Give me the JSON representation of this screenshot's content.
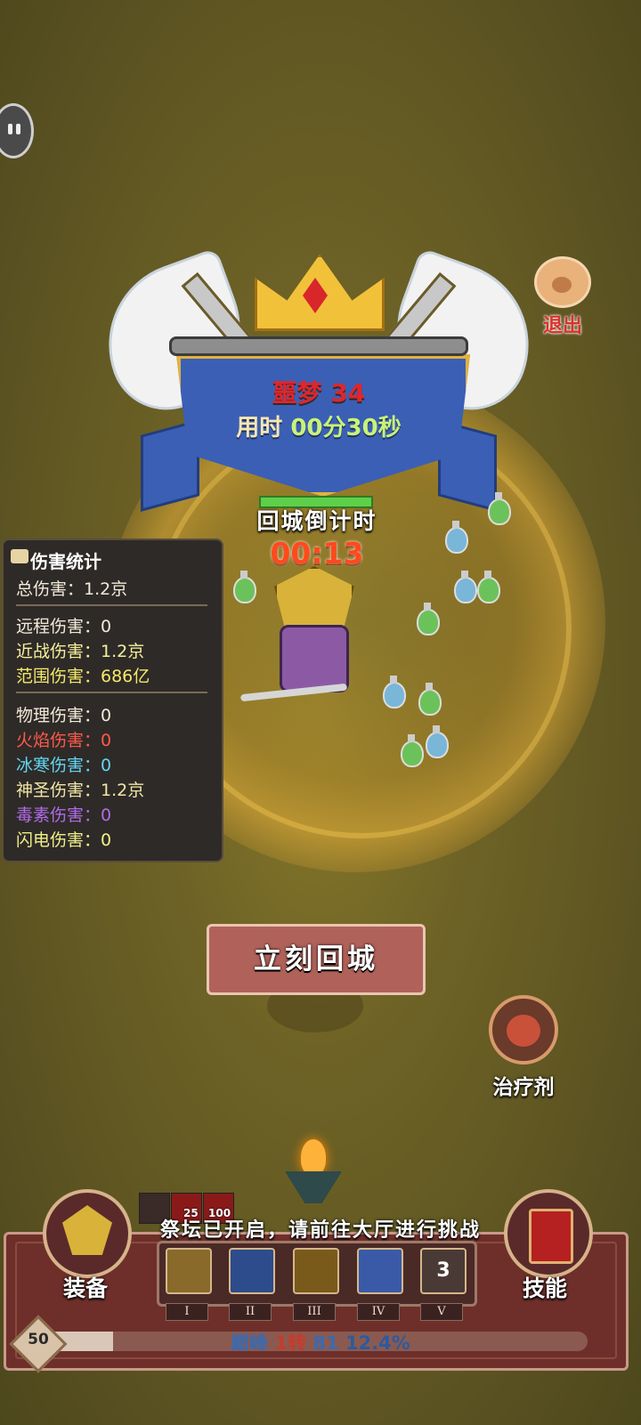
{
  "header": {
    "mode_title": "噩梦 34",
    "time_used_prefix": "用时",
    "time_used_value": "00分30秒"
  },
  "exit": {
    "label": "退出"
  },
  "countdown": {
    "label": "回城倒计时",
    "value": "00:13"
  },
  "damage_stats": {
    "title": "伤害统计",
    "total": "总伤害：1.2京",
    "group1": [
      "远程伤害：0",
      "近战伤害：1.2京",
      "范围伤害：686亿"
    ],
    "group2": [
      "物理伤害：0",
      "火焰伤害：0",
      "冰寒伤害：0",
      "神圣伤害：1.2京",
      "毒素伤害：0",
      "闪电伤害：0"
    ]
  },
  "return_button": {
    "label": "立刻回城"
  },
  "heal_potion": {
    "label": "治疗剂"
  },
  "notice": "祭坛已开启，请前往大厅进行挑战",
  "buffs": {
    "b_count": "25",
    "c_count": "100"
  },
  "bottom": {
    "equip_label": "装备",
    "skill_label": "技能",
    "slot5_count": "3",
    "roman": [
      "I",
      "II",
      "III",
      "IV",
      "V"
    ]
  },
  "progress": {
    "level": "50",
    "peak": "巅峰",
    "turn": "1转",
    "peak_level": "81",
    "percent_text": "12.4%",
    "fraction": 0.124
  },
  "colors": {
    "fire": "#ff5a4a",
    "ice": "#63d6f0",
    "poison": "#b06be6",
    "thunder": "#f0f08a",
    "countdown": "#ff4a1c",
    "title_red": "#e0262b"
  },
  "icons": [
    "pause-icon",
    "paw-icon",
    "scroll-icon",
    "potion-icon",
    "brazier-icon",
    "shield-skill-icon",
    "lightning-skill-icon",
    "bell-skill-icon",
    "wind-skill-icon",
    "hood-skill-icon"
  ]
}
